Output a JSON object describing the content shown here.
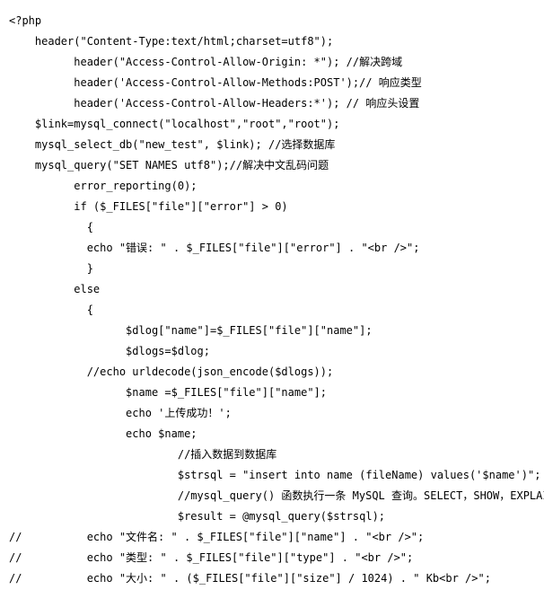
{
  "lines": [
    "<?php",
    "    header(\"Content-Type:text/html;charset=utf8\");",
    "          header(\"Access-Control-Allow-Origin: *\"); //解决跨域",
    "          header('Access-Control-Allow-Methods:POST');// 响应类型",
    "          header('Access-Control-Allow-Headers:*'); // 响应头设置",
    "    $link=mysql_connect(\"localhost\",\"root\",\"root\");",
    "    mysql_select_db(\"new_test\", $link); //选择数据库",
    "    mysql_query(\"SET NAMES utf8\");//解决中文乱码问题",
    "          error_reporting(0);",
    "          if ($_FILES[\"file\"][\"error\"] > 0)",
    "            {",
    "            echo \"错误: \" . $_FILES[\"file\"][\"error\"] . \"<br />\";",
    "            }",
    "          else",
    "            {",
    "                  $dlog[\"name\"]=$_FILES[\"file\"][\"name\"];",
    "                  $dlogs=$dlog;",
    "            //echo urldecode(json_encode($dlogs));",
    "                  $name =$_FILES[\"file\"][\"name\"];",
    "                  echo '上传成功！';",
    "                  echo $name;",
    "                          //插入数据到数据库",
    "                          $strsql = \"insert into name (fileName) values('$name')\";",
    "                          //mysql_query() 函数执行一条 MySQL 查询。SELECT，SHOW，EXPLAIN",
    "                          $result = @mysql_query($strsql);",
    "//          echo \"文件名: \" . $_FILES[\"file\"][\"name\"] . \"<br />\";",
    "//          echo \"类型: \" . $_FILES[\"file\"][\"type\"] . \"<br />\";",
    "//          echo \"大小: \" . ($_FILES[\"file\"][\"size\"] / 1024) . \" Kb<br />\";"
  ]
}
